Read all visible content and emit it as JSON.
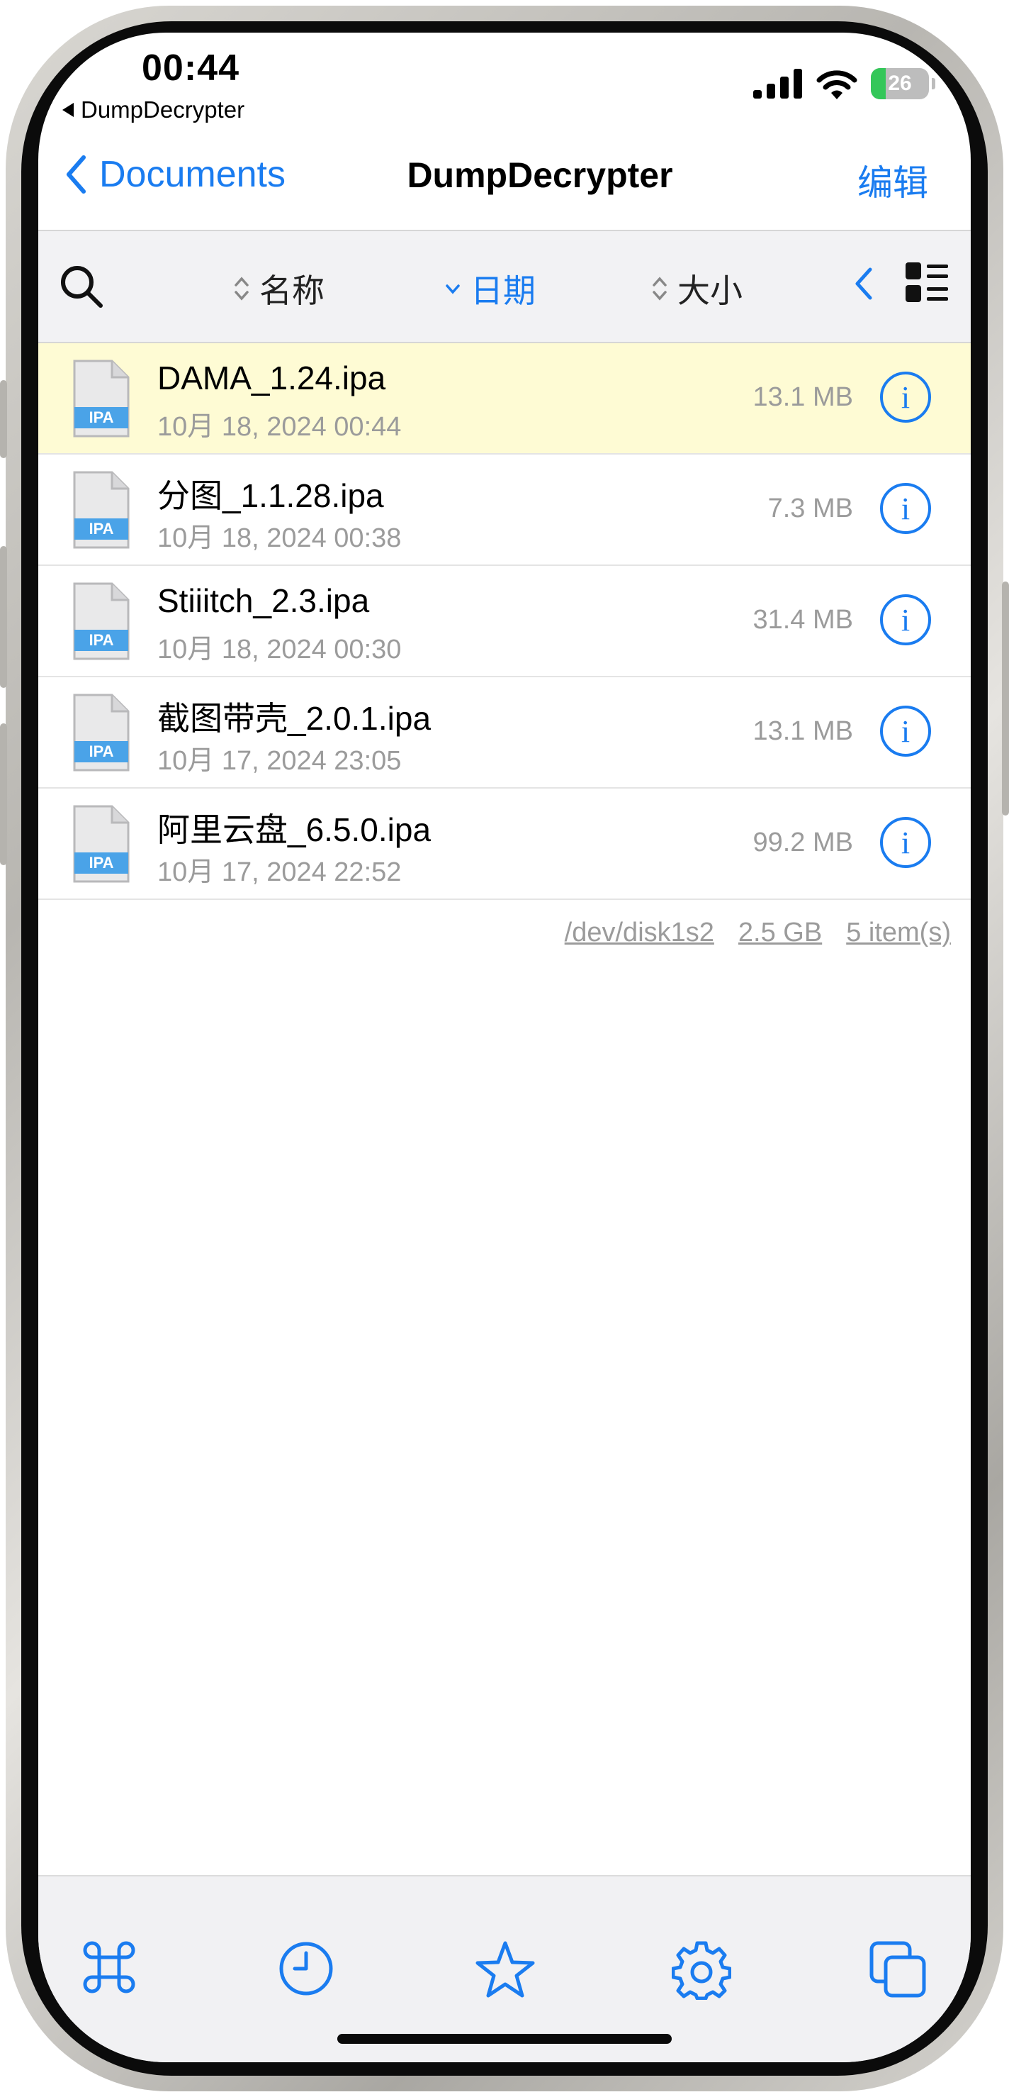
{
  "status_bar": {
    "time": "00:44",
    "back_app": "DumpDecrypter",
    "battery": "26",
    "battery_level_percent": 26
  },
  "nav": {
    "back_label": "Documents",
    "title": "DumpDecrypter",
    "edit_label": "编辑"
  },
  "sort_bar": {
    "name_label": "名称",
    "date_label": "日期",
    "size_label": "大小",
    "active_sort": "date"
  },
  "files": [
    {
      "name": "DAMA_1.24.ipa",
      "date": "10月 18, 2024 00:44",
      "size": "13.1 MB",
      "icon_label": "IPA",
      "highlighted": true
    },
    {
      "name": "分图_1.1.28.ipa",
      "date": "10月 18, 2024 00:38",
      "size": "7.3 MB",
      "icon_label": "IPA",
      "highlighted": false
    },
    {
      "name": "Stiiitch_2.3.ipa",
      "date": "10月 18, 2024 00:30",
      "size": "31.4 MB",
      "icon_label": "IPA",
      "highlighted": false
    },
    {
      "name": "截图带壳_2.0.1.ipa",
      "date": "10月 17, 2024 23:05",
      "size": "13.1 MB",
      "icon_label": "IPA",
      "highlighted": false
    },
    {
      "name": "阿里云盘_6.5.0.ipa",
      "date": "10月 17, 2024 22:52",
      "size": "99.2 MB",
      "icon_label": "IPA",
      "highlighted": false
    }
  ],
  "footer": {
    "disk": "/dev/disk1s2",
    "free_space": "2.5 GB",
    "item_count": "5 item(s)"
  },
  "tab_bar": {
    "tabs": [
      "command-icon",
      "clock-icon",
      "star-icon",
      "gear-icon",
      "windows-icon"
    ]
  },
  "colors": {
    "accent": "#1a7cf0",
    "highlight_row": "#fefbd4",
    "ipa_badge": "#4aa3e8",
    "battery_fill": "#34c759"
  }
}
